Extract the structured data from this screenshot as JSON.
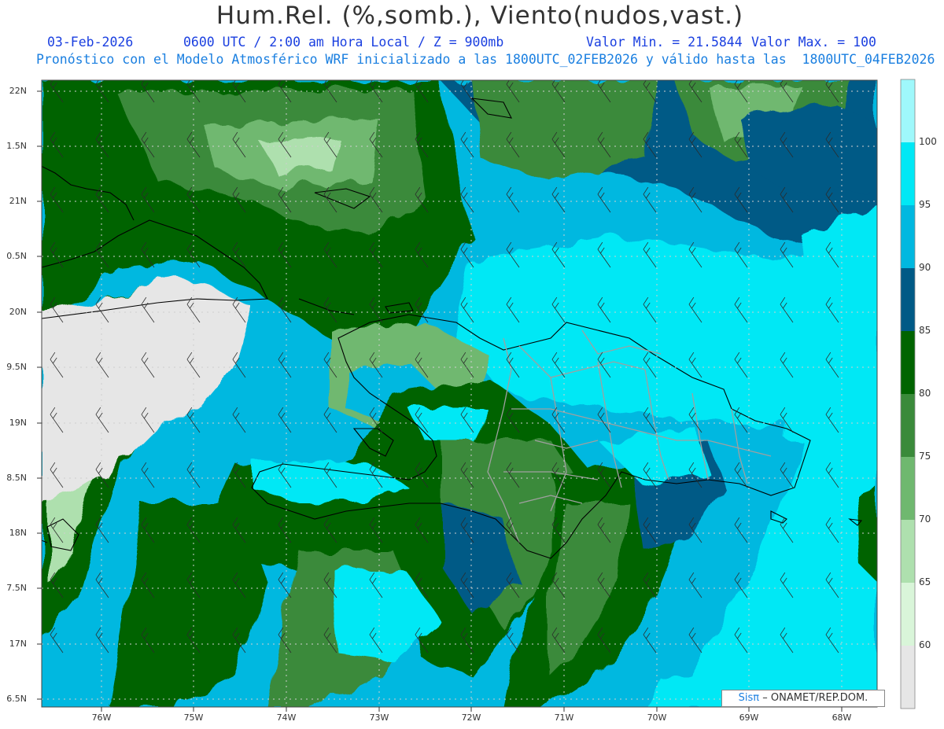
{
  "header": {
    "title": "Hum.Rel. (%,somb.), Viento(nudos,vast.)",
    "date": "03-Feb-2026",
    "time_info": "0600 UTC / 2:00 am Hora Local / Z = 900mb",
    "min_value": "Valor Min. = 21.5844",
    "max_value": "Valor Max. = 100",
    "forecast_line": "Pronóstico con el Modelo Atmosférico WRF inicializado a las 1800UTC_02FEB2026 y válido hasta las  1800UTC_04FEB2026"
  },
  "axes": {
    "lat_labels": [
      "22N",
      "1.5N",
      "21N",
      "0.5N",
      "20N",
      "9.5N",
      "19N",
      "8.5N",
      "18N",
      "7.5N",
      "17N",
      "6.5N"
    ],
    "lon_labels": [
      "76W",
      "75W",
      "74W",
      "73W",
      "72W",
      "71W",
      "70W",
      "69W",
      "68W"
    ]
  },
  "colorbar": {
    "labels": [
      "100",
      "95",
      "90",
      "85",
      "80",
      "75",
      "70",
      "65",
      "60"
    ],
    "colors": [
      "#9ff8fb",
      "#00e8f5",
      "#00b8e0",
      "#005a86",
      "#006400",
      "#3a8a3a",
      "#6fb86f",
      "#aee0ae",
      "#d9f5d9",
      "#e6e6e6"
    ]
  },
  "map_colors": {
    "background": "#00b8e0",
    "light_cyan": "#00e8f5",
    "dark_blue": "#005a86",
    "dark_green": "#006400",
    "med_green": "#3a8a3a",
    "light_green": "#6fb86f",
    "pale_green": "#aee0ae",
    "gray": "#e6e6e6",
    "coast": "#000000",
    "provinces": "#a0a0a0"
  },
  "credit": {
    "brand": "Sisπ",
    "org": "– ONAMET/REP.DOM."
  }
}
